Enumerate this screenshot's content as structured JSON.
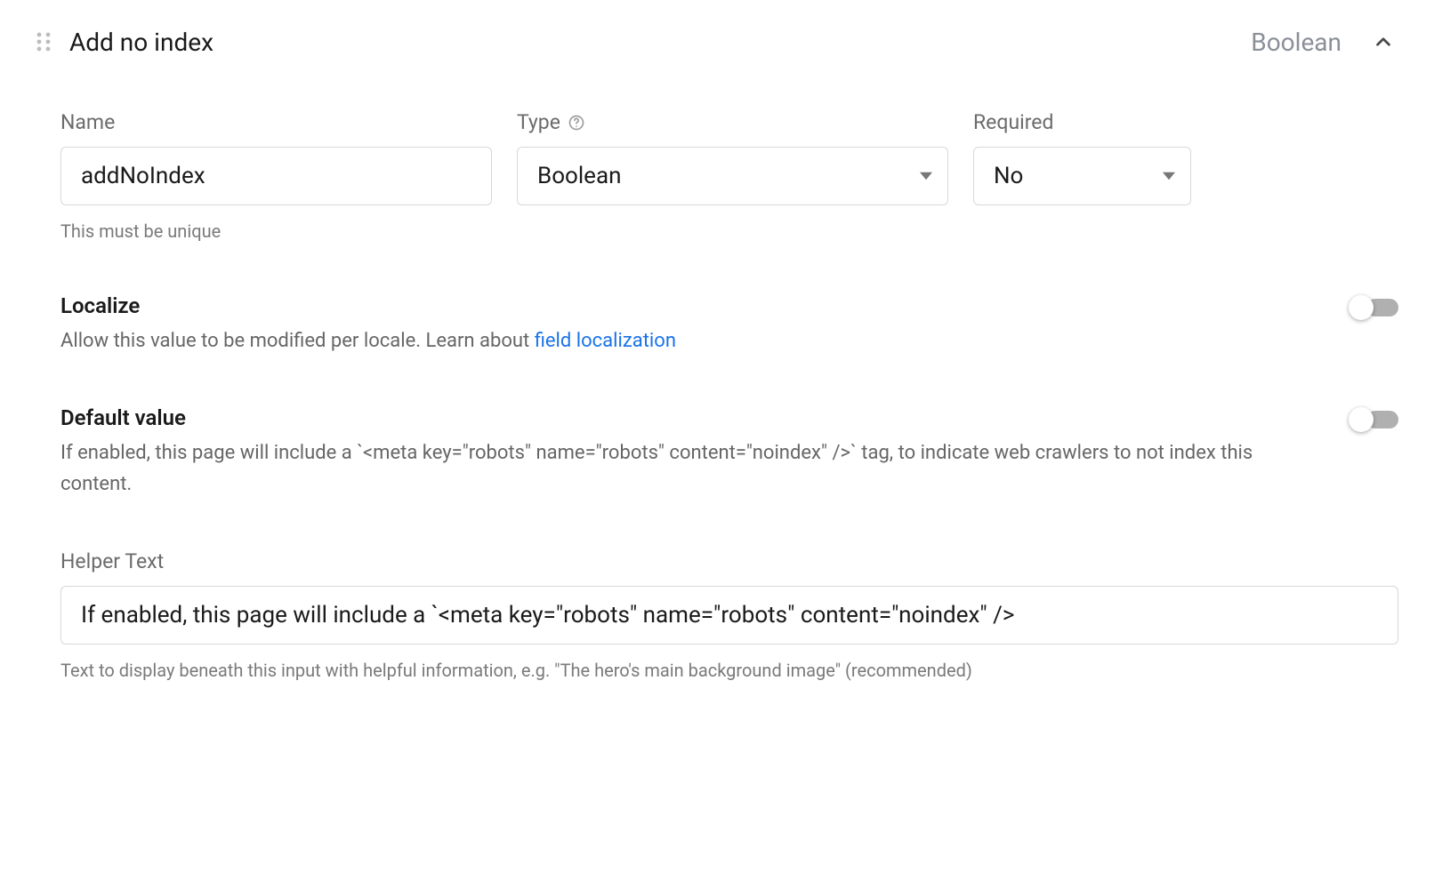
{
  "header": {
    "title": "Add no index",
    "type_label": "Boolean"
  },
  "fields": {
    "name": {
      "label": "Name",
      "value": "addNoIndex",
      "hint": "This must be unique"
    },
    "type": {
      "label": "Type",
      "value": "Boolean"
    },
    "required": {
      "label": "Required",
      "value": "No"
    }
  },
  "localize": {
    "title": "Localize",
    "desc_prefix": "Allow this value to be modified per locale. Learn about ",
    "link_text": "field localization",
    "enabled": false
  },
  "default_value": {
    "title": "Default value",
    "desc": "If enabled, this page will include a `<meta key=\"robots\" name=\"robots\" content=\"noindex\" />` tag, to indicate web crawlers to not index this content.",
    "enabled": false
  },
  "helper_text": {
    "label": "Helper Text",
    "value": "If enabled, this page will include a `<meta key=\"robots\" name=\"robots\" content=\"noindex\" />",
    "hint": "Text to display beneath this input with helpful information, e.g. \"The hero's main background image\" (recommended)"
  }
}
